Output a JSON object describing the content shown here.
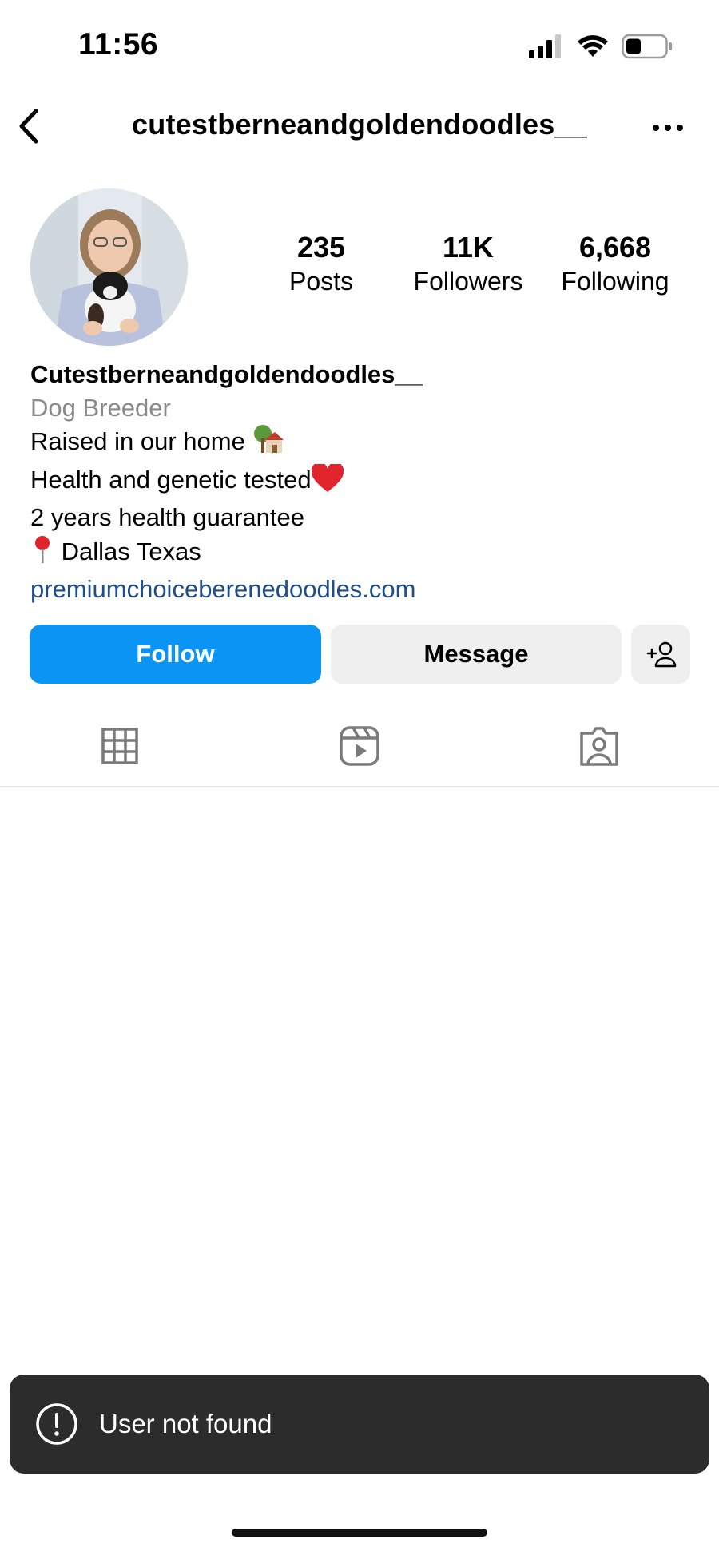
{
  "status_bar": {
    "time": "11:56"
  },
  "header": {
    "username": "cutestberneandgoldendoodles__"
  },
  "stats": [
    {
      "value": "235",
      "label": "Posts"
    },
    {
      "value": "11K",
      "label": "Followers"
    },
    {
      "value": "6,668",
      "label": "Following"
    }
  ],
  "bio": {
    "name": "Cutestberneandgoldendoodles__",
    "category": "Dog Breeder",
    "line1": "Raised in our home",
    "line2": "Health and genetic tested",
    "line3": "2 years health guarantee",
    "line4": "Dallas Texas",
    "link": "premiumchoiceberenedoodles.com"
  },
  "actions": {
    "follow_label": "Follow",
    "message_label": "Message"
  },
  "tabs": [
    {
      "icon": "grid-icon"
    },
    {
      "icon": "reels-icon"
    },
    {
      "icon": "tagged-icon"
    }
  ],
  "toast": {
    "message": "User not found"
  },
  "colors": {
    "follow_blue": "#0a95f5",
    "link_blue": "#1f4e8a",
    "toast_bg": "#2c2c2c"
  }
}
